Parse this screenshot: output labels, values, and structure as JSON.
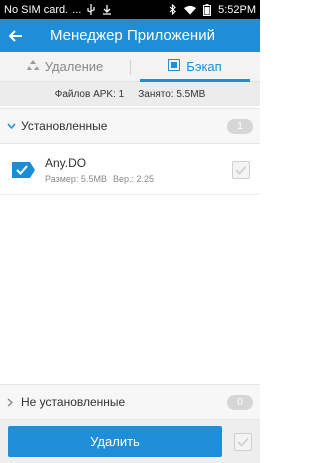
{
  "statusbar": {
    "carrier": "No SIM card.",
    "extra": "...",
    "time": "5:52PM",
    "icons": [
      "usb-icon",
      "download-icon",
      "bluetooth-icon",
      "wifi-icon",
      "battery-icon"
    ]
  },
  "appbar": {
    "title": "Менеджер Приложений"
  },
  "tabs": [
    {
      "label": "Удаление",
      "icon": "recycle-icon",
      "active": false
    },
    {
      "label": "Бэкап",
      "icon": "backup-icon",
      "active": true
    }
  ],
  "info": {
    "apk_files": "Файлов APK: 1",
    "occupied": "Занято: 5.5MB"
  },
  "groups": {
    "installed": {
      "label": "Установленные",
      "count": "1"
    },
    "not_installed": {
      "label": "Не установленные",
      "count": "0"
    }
  },
  "apps": [
    {
      "name": "Any.DO",
      "size": "Размер: 5.5MB",
      "version": "Вер.: 2.25",
      "checked": false
    }
  ],
  "bottom": {
    "delete_label": "Удалить"
  },
  "colors": {
    "accent": "#1d8ed7",
    "tab_active": "#1d8ed7",
    "status_bg": "#000000"
  }
}
